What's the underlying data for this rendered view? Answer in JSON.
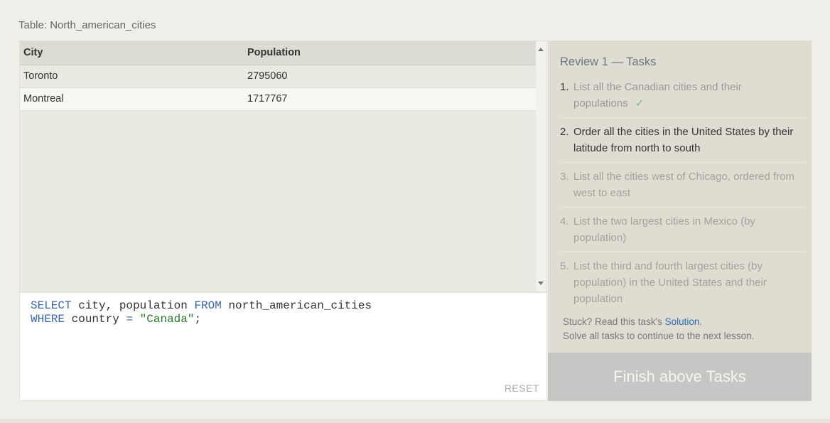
{
  "table_caption": "Table: North_american_cities",
  "results": {
    "headers": [
      "City",
      "Population"
    ],
    "rows": [
      [
        "Toronto",
        "2795060"
      ],
      [
        "Montreal",
        "1717767"
      ]
    ]
  },
  "editor": {
    "line1": {
      "kw1": "SELECT",
      "t1": " city, population ",
      "kw2": "FROM",
      "t2": " north_american_cities"
    },
    "line2": {
      "kw1": "WHERE",
      "t1": " country ",
      "op": "=",
      "t2": " ",
      "str": "\"Canada\"",
      "t3": ";"
    },
    "reset_label": "RESET"
  },
  "tasks": {
    "title": "Review 1 — Tasks",
    "items": [
      {
        "num": "1.",
        "text": "List all the Canadian cities and their populations",
        "check": "✓"
      },
      {
        "num": "2.",
        "text": "Order all the cities in the United States by their latitude from north to south"
      },
      {
        "num": "3.",
        "text": "List all the cities west of Chicago, ordered from west to east"
      },
      {
        "num": "4.",
        "text": "List the two largest cities in Mexico (by population)"
      },
      {
        "num": "5.",
        "text": "List the third and fourth largest cities (by population) in the United States and their population"
      }
    ],
    "help_prefix": "Stuck? Read this task's ",
    "help_link": "Solution",
    "help_suffix": ".",
    "help_line2": "Solve all tasks to continue to the next lesson.",
    "finish_label": "Finish above Tasks"
  },
  "colors": {
    "keyword": "#3a64a8",
    "string": "#2a7a2a",
    "check": "#6cc07a",
    "link": "#2a6db8"
  }
}
